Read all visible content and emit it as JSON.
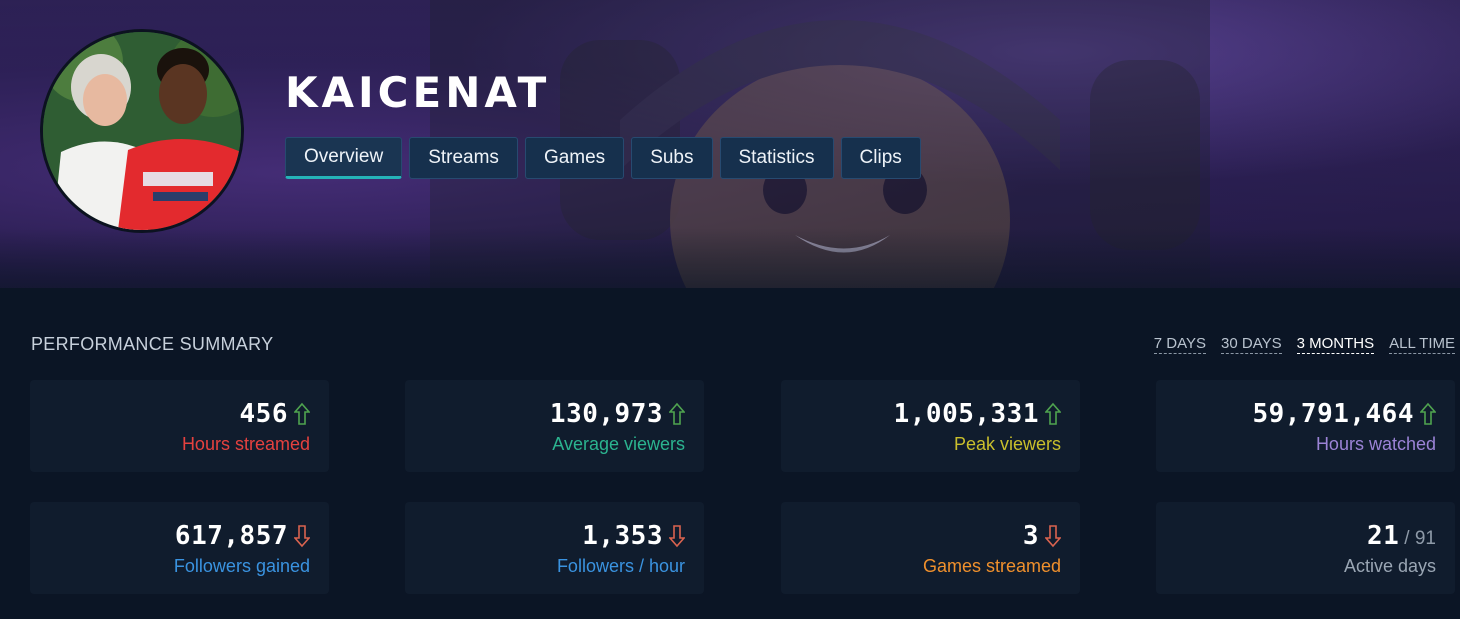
{
  "channel": {
    "name": "KAICENAT"
  },
  "tabs": [
    {
      "label": "Overview",
      "active": true
    },
    {
      "label": "Streams"
    },
    {
      "label": "Games"
    },
    {
      "label": "Subs"
    },
    {
      "label": "Statistics"
    },
    {
      "label": "Clips"
    }
  ],
  "summary": {
    "title": "PERFORMANCE SUMMARY",
    "ranges": [
      {
        "label": "7 DAYS"
      },
      {
        "label": "30 DAYS"
      },
      {
        "label": "3 MONTHS",
        "active": true
      },
      {
        "label": "ALL TIME"
      }
    ],
    "cards": [
      {
        "value": "456",
        "label": "Hours streamed",
        "trend": "up",
        "label_color": "#e5413f"
      },
      {
        "value": "130,973",
        "label": "Average viewers",
        "trend": "up",
        "label_color": "#2bb38f"
      },
      {
        "value": "1,005,331",
        "label": "Peak viewers",
        "trend": "up",
        "label_color": "#c9bf2c"
      },
      {
        "value": "59,791,464",
        "label": "Hours watched",
        "trend": "up",
        "label_color": "#9b83d6"
      },
      {
        "value": "617,857",
        "label": "Followers gained",
        "trend": "down",
        "label_color": "#3a93e0"
      },
      {
        "value": "1,353",
        "label": "Followers / hour",
        "trend": "down",
        "label_color": "#3a93e0"
      },
      {
        "value": "3",
        "label": "Games streamed",
        "trend": "down",
        "label_color": "#f0902c"
      },
      {
        "value": "21",
        "suffix": "/ 91",
        "label": "Active days",
        "trend": "none",
        "label_color": "#9aa6b4"
      }
    ]
  },
  "colors": {
    "trend_up": "#4fa34f",
    "trend_down": "#d9634f",
    "accent": "#25b3b8"
  }
}
